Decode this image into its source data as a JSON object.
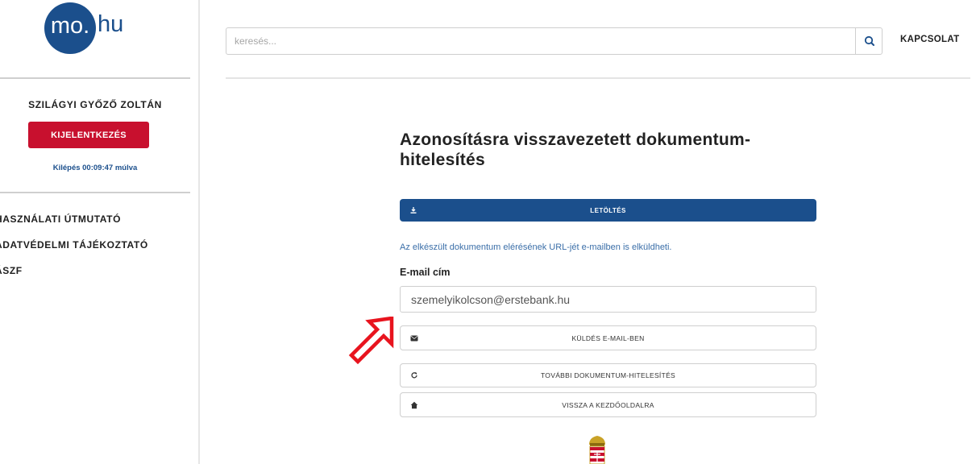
{
  "logo": {
    "circle_text": "mo.",
    "rest_text": "hu"
  },
  "user": {
    "name": "SZILÁGYI GYŐZŐ ZOLTÁN",
    "logout_label": "KIJELENTKEZÉS",
    "session_text": "Kilépés 00:09:47 múlva"
  },
  "sidebar": {
    "items": [
      {
        "label": "HASZNÁLATI ÚTMUTATÓ"
      },
      {
        "label": "ADATVÉDELMI TÁJÉKOZTATÓ"
      },
      {
        "label": "ÁSZF"
      }
    ]
  },
  "header": {
    "search_placeholder": "keresés...",
    "search_icon": "search-icon",
    "contact_label": "KAPCSOLAT"
  },
  "main": {
    "title": "Azonosításra visszavezetett dokumentum-hitelesítés",
    "download_label": "LETÖLTÉS",
    "download_icon": "download-icon",
    "info_text": "Az elkészült dokumentum elérésének URL-jét e-mailben is elküldheti.",
    "email_label": "E-mail cím",
    "email_value": "szemelyikolcson@erstebank.hu",
    "buttons": [
      {
        "label": "KÜLDÉS E-MAIL-BEN",
        "icon": "envelope-icon"
      },
      {
        "label": "TOVÁBBI DOKUMENTUM-HITELESÍTÉS",
        "icon": "refresh-icon"
      },
      {
        "label": "VISSZA A KEZDŐOLDALRA",
        "icon": "home-icon"
      }
    ]
  },
  "colors": {
    "brand_blue": "#1b4f8c",
    "logout_red": "#c8102e",
    "annotation_red": "#e8141e"
  }
}
